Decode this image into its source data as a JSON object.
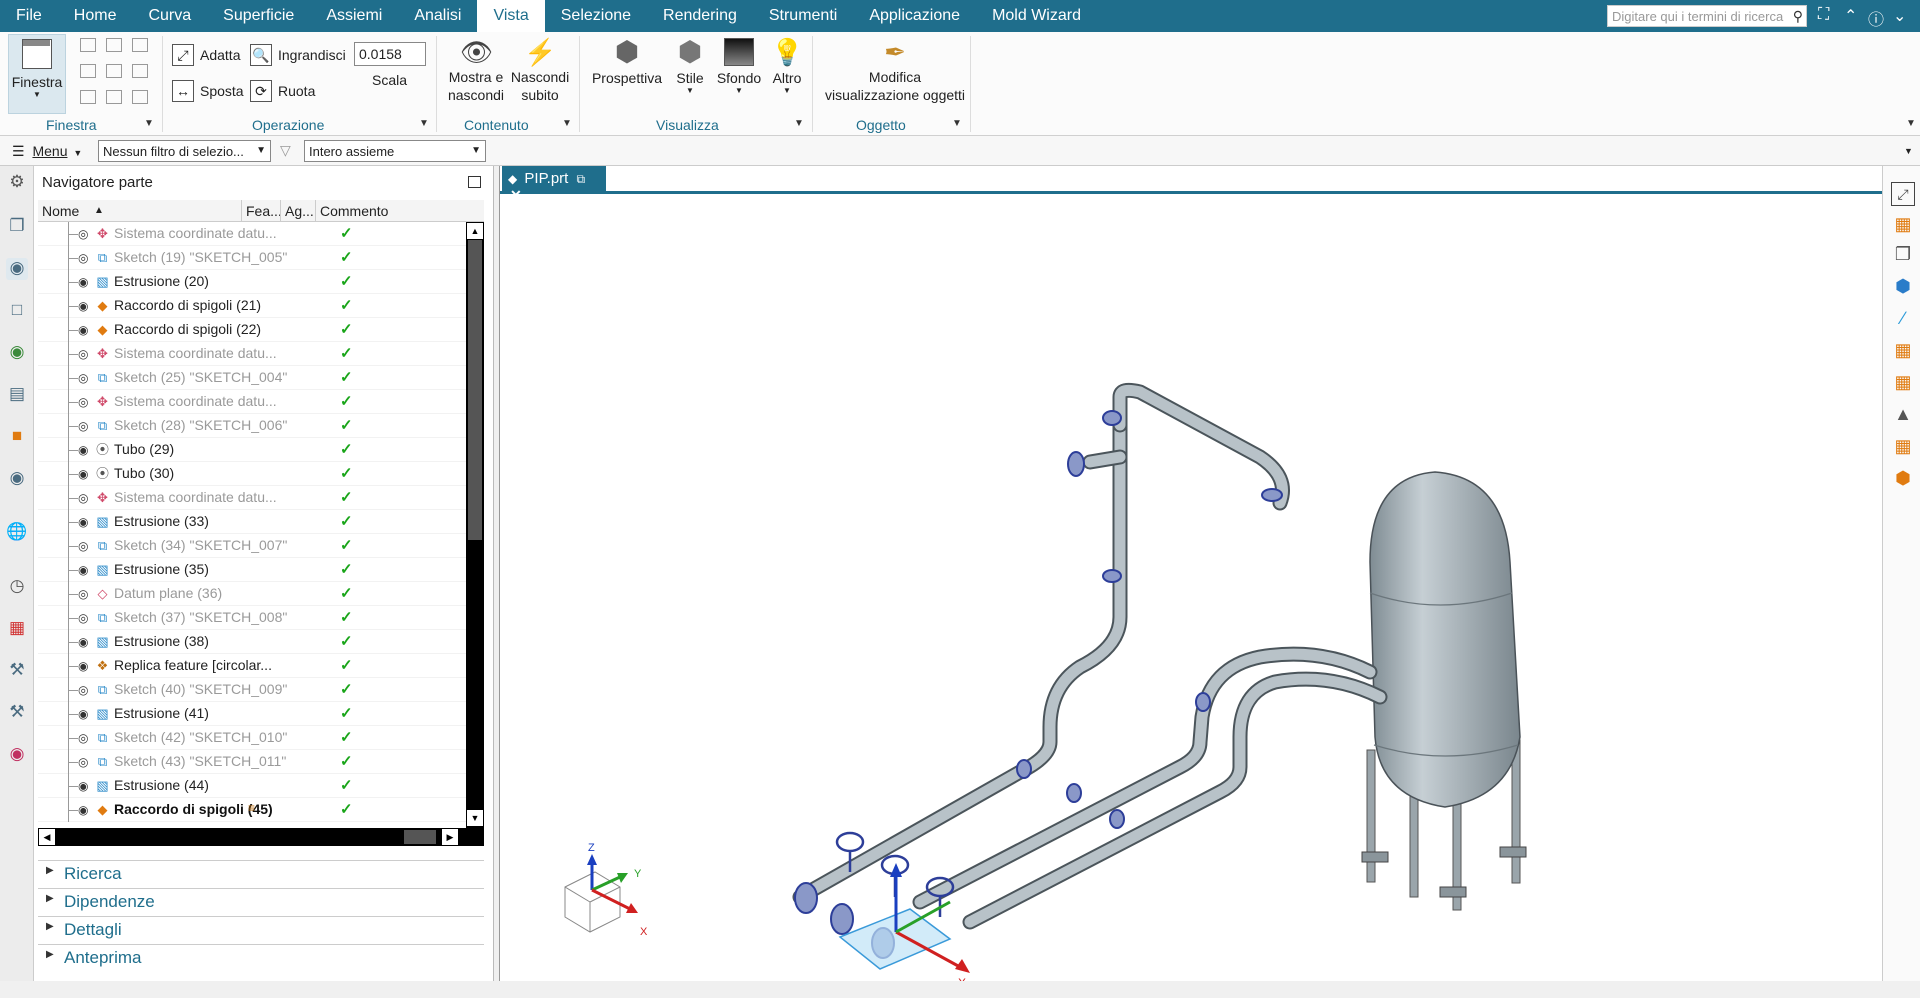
{
  "menubar": {
    "items": [
      "File",
      "Home",
      "Curva",
      "Superficie",
      "Assiemi",
      "Analisi",
      "Vista",
      "Selezione",
      "Rendering",
      "Strumenti",
      "Applicazione",
      "Mold Wizard"
    ],
    "active": "Vista",
    "search_placeholder": "Digitare qui i termini di ricerca"
  },
  "ribbon": {
    "finestra": {
      "button": "Finestra",
      "group": "Finestra"
    },
    "operazione": {
      "adatta": "Adatta",
      "ingrandisci": "Ingrandisci",
      "sposta": "Sposta",
      "ruota": "Ruota",
      "scale_value": "0.0158",
      "scala": "Scala",
      "group": "Operazione"
    },
    "contenuto": {
      "mostra": "Mostra e\nnascondi",
      "nascondi": "Nascondi\nsubito",
      "group": "Contenuto"
    },
    "visualizza": {
      "prospettiva": "Prospettiva",
      "stile": "Stile",
      "sfondo": "Sfondo",
      "altro": "Altro",
      "group": "Visualizza"
    },
    "oggetto": {
      "modifica": "Modifica\nvisualizzazione oggetti",
      "group": "Oggetto"
    }
  },
  "toolbar2": {
    "menu": "Menu",
    "filter": "Nessun filtro di selezio...",
    "scope": "Intero assieme"
  },
  "navigator": {
    "title": "Navigatore parte",
    "columns": [
      "Nome",
      "Fea...",
      "Ag...",
      "Commento"
    ],
    "rows": [
      {
        "name": "Sistema coordinate datu...",
        "icon": "csys-icon",
        "dim": true
      },
      {
        "name": "Sketch (19) \"SKETCH_005\"",
        "icon": "sketch-icon",
        "dim": true
      },
      {
        "name": "Estrusione (20)",
        "icon": "extrude-icon",
        "dim": false
      },
      {
        "name": "Raccordo di spigoli (21)",
        "icon": "blend-icon",
        "dim": false
      },
      {
        "name": "Raccordo di spigoli (22)",
        "icon": "blend-icon",
        "dim": false
      },
      {
        "name": "Sistema coordinate datu...",
        "icon": "csys-icon",
        "dim": true
      },
      {
        "name": "Sketch (25) \"SKETCH_004\"",
        "icon": "sketch-icon",
        "dim": true
      },
      {
        "name": "Sistema coordinate datu...",
        "icon": "csys-icon",
        "dim": true
      },
      {
        "name": "Sketch (28) \"SKETCH_006\"",
        "icon": "sketch-icon",
        "dim": true
      },
      {
        "name": "Tubo (29)",
        "icon": "tube-icon",
        "dim": false
      },
      {
        "name": "Tubo (30)",
        "icon": "tube-icon",
        "dim": false
      },
      {
        "name": "Sistema coordinate datu...",
        "icon": "csys-icon",
        "dim": true
      },
      {
        "name": "Estrusione (33)",
        "icon": "extrude-icon",
        "dim": false
      },
      {
        "name": "Sketch (34) \"SKETCH_007\"",
        "icon": "sketch-icon",
        "dim": true
      },
      {
        "name": "Estrusione (35)",
        "icon": "extrude-icon",
        "dim": false
      },
      {
        "name": "Datum plane (36)",
        "icon": "datum-plane-icon",
        "dim": true
      },
      {
        "name": "Sketch (37) \"SKETCH_008\"",
        "icon": "sketch-icon",
        "dim": true
      },
      {
        "name": "Estrusione (38)",
        "icon": "extrude-icon",
        "dim": false
      },
      {
        "name": "Replica feature [circolar...",
        "icon": "pattern-icon",
        "dim": false
      },
      {
        "name": "Sketch (40) \"SKETCH_009\"",
        "icon": "sketch-icon",
        "dim": true
      },
      {
        "name": "Estrusione (41)",
        "icon": "extrude-icon",
        "dim": false
      },
      {
        "name": "Sketch (42) \"SKETCH_010\"",
        "icon": "sketch-icon",
        "dim": true
      },
      {
        "name": "Sketch (43) \"SKETCH_011\"",
        "icon": "sketch-icon",
        "dim": true
      },
      {
        "name": "Estrusione (44)",
        "icon": "extrude-icon",
        "dim": false
      },
      {
        "name": "Raccordo di spigoli (45)",
        "icon": "blend-icon",
        "dim": false,
        "bold": true
      }
    ],
    "sections": [
      "Ricerca",
      "Dipendenze",
      "Dettagli",
      "Anteprima"
    ]
  },
  "tab": {
    "label": "PIP.prt"
  },
  "triad": {
    "x": "X",
    "y": "Y",
    "z": "Z"
  },
  "colors": {
    "brand": "#1f6e8c",
    "check": "#1aa51a",
    "pipe": "#a9b4bb",
    "flange": "#3b4fb5"
  }
}
